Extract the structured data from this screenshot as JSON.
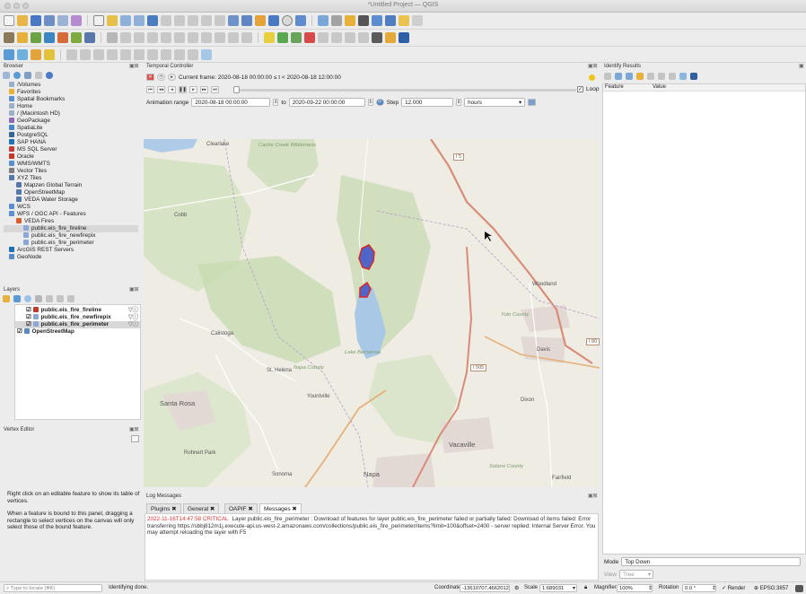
{
  "window": {
    "title": "*Untitled Project — QGIS"
  },
  "browser": {
    "title": "Browser",
    "items": [
      {
        "label": "/Volumes",
        "icon": "folder-icon"
      },
      {
        "label": "Favorites",
        "icon": "star-icon"
      },
      {
        "label": "Spatial Bookmarks",
        "icon": "bookmark-icon"
      },
      {
        "label": "Home",
        "icon": "home-folder-icon"
      },
      {
        "label": "/ (Macintosh HD)",
        "icon": "folder-icon"
      },
      {
        "label": "GeoPackage",
        "icon": "geopackage-icon"
      },
      {
        "label": "SpatiaLite",
        "icon": "spatialite-icon"
      },
      {
        "label": "PostgreSQL",
        "icon": "postgresql-icon"
      },
      {
        "label": "SAP HANA",
        "icon": "sap-hana-icon"
      },
      {
        "label": "MS SQL Server",
        "icon": "mssql-icon"
      },
      {
        "label": "Oracle",
        "icon": "oracle-icon"
      },
      {
        "label": "WMS/WMTS",
        "icon": "wms-icon"
      },
      {
        "label": "Vector Tiles",
        "icon": "vector-tiles-icon"
      },
      {
        "label": "XYZ Tiles",
        "icon": "xyz-tiles-icon"
      },
      {
        "label": "Mapzen Global Terrain",
        "icon": "tile-layer-icon"
      },
      {
        "label": "OpenStreetMap",
        "icon": "tile-layer-icon"
      },
      {
        "label": "VEDA Water Storage",
        "icon": "tile-layer-icon"
      },
      {
        "label": "WCS",
        "icon": "wcs-icon"
      },
      {
        "label": "WFS / OGC API - Features",
        "icon": "wfs-icon"
      },
      {
        "label": "VEDA Fires",
        "icon": "connection-icon"
      },
      {
        "label": "public.eis_fire_fireline",
        "icon": "polygon-layer-icon"
      },
      {
        "label": "public.eis_fire_newfirepix",
        "icon": "polygon-layer-icon"
      },
      {
        "label": "public.eis_fire_perimeter",
        "icon": "polygon-layer-icon"
      },
      {
        "label": "ArcGIS REST Servers",
        "icon": "arcgis-icon"
      },
      {
        "label": "GeoNode",
        "icon": "geonode-icon"
      }
    ]
  },
  "layers": {
    "title": "Layers",
    "items": [
      {
        "label": "public.eis_fire_fireline",
        "checked": true
      },
      {
        "label": "public.eis_fire_newfirepix",
        "checked": true
      },
      {
        "label": "public.eis_fire_perimeter",
        "checked": true
      },
      {
        "label": "OpenStreetMap",
        "checked": true
      }
    ]
  },
  "vertex_editor": {
    "title": "Vertex Editor",
    "help1": "Right click on an editable feature to show its table of vertices.",
    "help2": "When a feature is bound to this panel, dragging a rectangle to select vertices on the canvas will only select those of the bound feature."
  },
  "temporal": {
    "title": "Temporal Controller",
    "frame": "Current frame: 2020-08-18 00:00:00 ≤ t < 2020-08-18 12:00:00",
    "loop": "Loop",
    "range_label": "Animation range",
    "range_start": "2020-08-18 00:00:00",
    "to": "to",
    "range_end": "2020-09-22 00:00:00",
    "step_label": "Step",
    "step": "12.000",
    "unit": "hours"
  },
  "map": {
    "labels": [
      {
        "text": "Clearlake",
        "style": ""
      },
      {
        "text": "Cache Creek Wilderness",
        "style": "green"
      },
      {
        "text": "Cobb",
        "style": ""
      },
      {
        "text": "Calistoga",
        "style": ""
      },
      {
        "text": "St. Helena",
        "style": ""
      },
      {
        "text": "Napa County",
        "style": "green"
      },
      {
        "text": "Lake Berryessa",
        "style": "green"
      },
      {
        "text": "Woodland",
        "style": ""
      },
      {
        "text": "Yolo County",
        "style": "green"
      },
      {
        "text": "Davis",
        "style": ""
      },
      {
        "text": "Dixon",
        "style": ""
      },
      {
        "text": "Santa Rosa",
        "style": ""
      },
      {
        "text": "Yountville",
        "style": ""
      },
      {
        "text": "Rohnert Park",
        "style": ""
      },
      {
        "text": "Sonoma",
        "style": ""
      },
      {
        "text": "Napa",
        "style": ""
      },
      {
        "text": "Vacaville",
        "style": ""
      },
      {
        "text": "Solano County",
        "style": "green"
      },
      {
        "text": "Fairfield",
        "style": ""
      },
      {
        "text": "I 5",
        "style": "road"
      },
      {
        "text": "I 505",
        "style": "road"
      },
      {
        "text": "I 80",
        "style": "road"
      }
    ]
  },
  "identify": {
    "title": "Identify Results",
    "col_feature": "Feature",
    "col_value": "Value",
    "mode_label": "Mode",
    "mode_value": "Top Down",
    "view_label": "View",
    "view_value": "Tree"
  },
  "log": {
    "title": "Log Messages",
    "tabs": [
      "Plugins",
      "General",
      "OAPIF",
      "Messages"
    ],
    "active_tab": "Messages",
    "message_head": "2022-11-16T14:47:58     CRITICAL",
    "message_body": "Layer public.eis_fire_perimeter : Download of features for layer public.eis_fire_perimeter failed or partially failed: Download of items failed: Error transferring https://sbbj812m1j.execute-api.us-west-2.amazonaws.com/collections/public.eis_fire_perimeter/items?limit=100&offset=2400 - server replied: Internal Server Error. You may attempt reloading the layer with F5"
  },
  "status": {
    "locate_placeholder": "Type to locate (⌘K)",
    "message": "Identifying done.",
    "coordinate_label": "Coordinate",
    "coordinate": "-13610707,4662012",
    "scale_label": "Scale",
    "scale": "1:689031",
    "magnifier_label": "Magnifier",
    "magnifier": "100%",
    "rotation_label": "Rotation",
    "rotation": "0.0 °",
    "render_label": "Render",
    "crs": "EPSG:3857"
  }
}
